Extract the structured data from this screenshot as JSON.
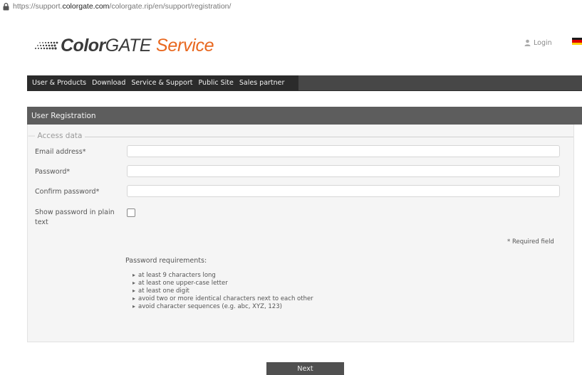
{
  "browser": {
    "url_prefix": "https://support.",
    "url_host": "colorgate.com",
    "url_path": "/colorgate.rip/en/support/registration/",
    "lock_icon": "lock-icon"
  },
  "header": {
    "logo_part1": "Color",
    "logo_part2": "GATE",
    "logo_part3": "Service",
    "login_label": "Login",
    "login_icon": "user-icon",
    "language_flag": "flag-germany-icon",
    "colors": {
      "brand_orange": "#e8671e",
      "logo_gray": "#3a3a3a"
    }
  },
  "nav": {
    "items": [
      {
        "label": "User & Products"
      },
      {
        "label": "Download"
      },
      {
        "label": "Service & Support"
      },
      {
        "label": "Public Site"
      },
      {
        "label": "Sales partner"
      }
    ],
    "colors": {
      "bar": "#474747",
      "active": "#2b2b2b"
    }
  },
  "section": {
    "title": "User Registration"
  },
  "form": {
    "legend": "Access data",
    "fields": [
      {
        "label": "Email address*",
        "value": "",
        "placeholder": ""
      },
      {
        "label": "Password*",
        "value": "",
        "placeholder": ""
      },
      {
        "label": "Confirm password*",
        "value": "",
        "placeholder": ""
      }
    ],
    "show_password": {
      "label_line1": "Show password in plain",
      "label_line2": "text",
      "checked": false
    },
    "required_note": "* Required field",
    "pw_requirements_title": "Password requirements:",
    "pw_requirements": [
      "at least 9 characters long",
      "at least one upper-case letter",
      "at least one digit",
      "avoid two or more identical characters next to each other",
      "avoid character sequences (e.g. abc, XYZ, 123)"
    ]
  },
  "actions": {
    "next_label": "Next"
  }
}
